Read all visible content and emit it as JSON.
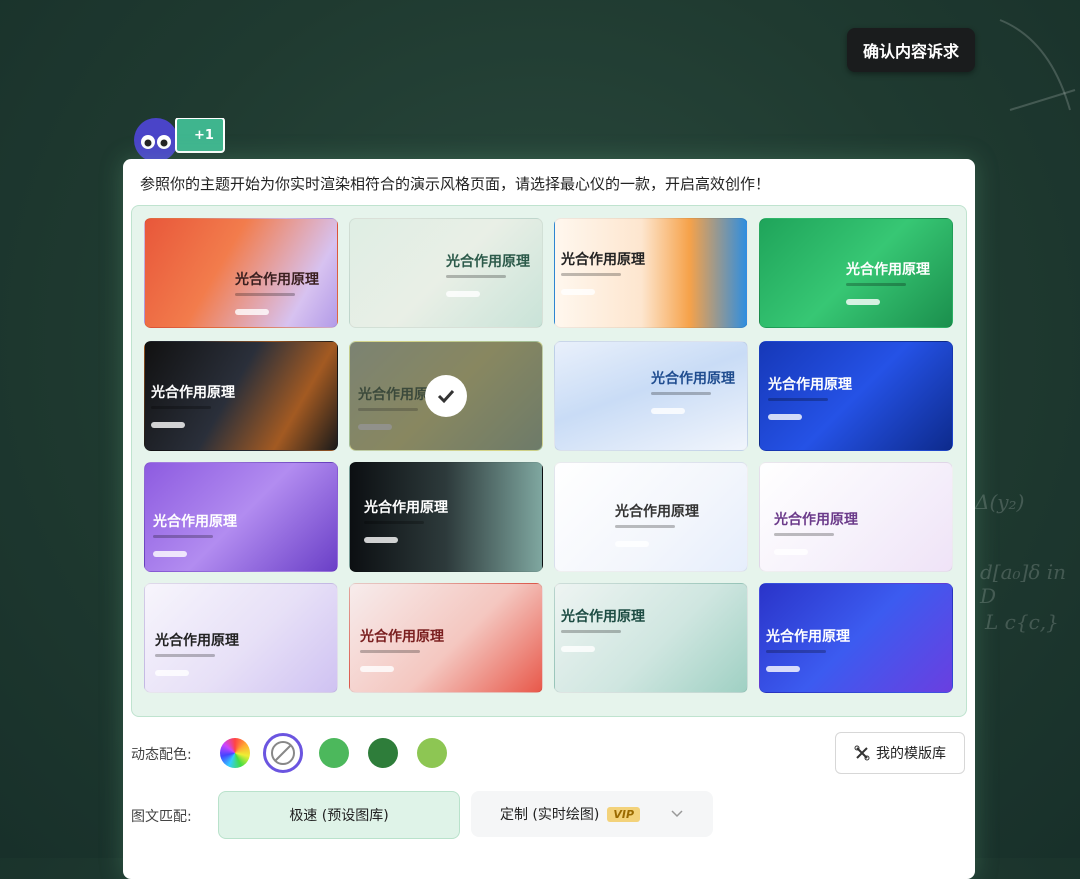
{
  "confirm_button": "确认内容诉求",
  "mascot_badge": "+1",
  "intro_text": "参照你的主题开始为你实时渲染相符合的演示风格页面，请选择最心仪的一款，开启高效创作！",
  "templates": [
    {
      "title": "光合作用原理",
      "bg": "linear-gradient(120deg,#e8573a 0%,#f27c4c 40%,#d7c2f0 80%,#b39be8 100%)",
      "color": "#3a1f1f"
    },
    {
      "title": "光合作用原理",
      "bg": "linear-gradient(135deg,#dfeee4 0%,#e9efe6 50%,#c9e3d8 100%)",
      "color": "#2c5a4a"
    },
    {
      "title": "光合作用原理",
      "bg": "linear-gradient(90deg,#fff7ee 0%,#fde6cf 45%,#f6a24a 70%,#2e8ee0 100%)",
      "color": "#222"
    },
    {
      "title": "光合作用原理",
      "bg": "linear-gradient(135deg,#1fa45a 0%,#37c774 50%,#1b8f4d 100%)",
      "color": "#fff"
    },
    {
      "title": "光合作用原理",
      "bg": "linear-gradient(120deg,#111 0%,#2a2f3a 45%,#a35a22 75%,#1a1a1a 100%)",
      "color": "#fff"
    },
    {
      "title": "光合作用原理",
      "bg": "linear-gradient(135deg,#c9d9b5 0%,#e5e38d 50%,#a9c7a0 100%)",
      "color": "#3b5a3a"
    },
    {
      "title": "光合作用原理",
      "bg": "linear-gradient(160deg,#e9f0fb 0%,#c9dcf6 45%,#f1f5fc 100%)",
      "color": "#1f4c8f"
    },
    {
      "title": "光合作用原理",
      "bg": "linear-gradient(135deg,#1638b8 0%,#2552e6 50%,#0d2a8c 100%)",
      "color": "#fff"
    },
    {
      "title": "光合作用原理",
      "bg": "linear-gradient(135deg,#8d5be0 0%,#b28cf0 50%,#6a3fc7 100%)",
      "color": "#fff"
    },
    {
      "title": "光合作用原理",
      "bg": "linear-gradient(90deg,#0c0f12 0%,#2d3a3b 50%,#7fa7a0 100%)",
      "color": "#fff"
    },
    {
      "title": "光合作用原理",
      "bg": "linear-gradient(135deg,#ffffff 0%,#f3f6fc 60%,#e6eefc 100%)",
      "color": "#333"
    },
    {
      "title": "光合作用原理",
      "bg": "linear-gradient(135deg,#ffffff 0%,#f6f1fb 55%,#efe3f7 100%)",
      "color": "#6b3a8a"
    },
    {
      "title": "光合作用原理",
      "bg": "linear-gradient(135deg,#f7f5fc 0%,#e7e0f7 55%,#cfc2f2 100%)",
      "color": "#222"
    },
    {
      "title": "光合作用原理",
      "bg": "linear-gradient(135deg,#f7ecec 0%,#f4c7c0 55%,#e8584a 100%)",
      "color": "#7a1f1f"
    },
    {
      "title": "光合作用原理",
      "bg": "linear-gradient(135deg,#eef4f2 0%,#cfe6e0 55%,#9fd0c3 100%)",
      "color": "#1d4c43"
    },
    {
      "title": "光合作用原理",
      "bg": "linear-gradient(135deg,#2a34c9 0%,#3c5bf0 50%,#6a3fe0 100%)",
      "color": "#fff"
    }
  ],
  "selected_index": 5,
  "color_row_label": "动态配色:",
  "swatches": {
    "rainbow": "conic-gradient(#f44,#fa3,#ee3,#4d4,#3cf,#44f,#c4f,#f44)",
    "none_selected_border": "#6b55e0",
    "green1": "#4cb85c",
    "green2": "#2e7d3a",
    "green3": "#8dc653"
  },
  "my_templates_button": "我的模版库",
  "match_row_label": "图文匹配:",
  "option_fast": "极速 (预设图库)",
  "option_custom": "定制 (实时绘图)",
  "vip_badge": "VIP",
  "colors": {
    "accent_purple": "#6b55e0",
    "grid_bg": "#e6f4ec",
    "fast_bg": "#dff3e8"
  }
}
